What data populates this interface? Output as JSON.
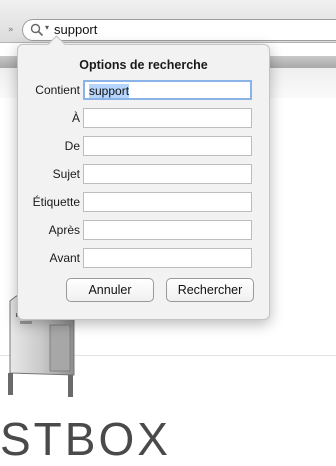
{
  "search": {
    "query": "support"
  },
  "popover": {
    "title": "Options de recherche",
    "fields": [
      {
        "label": "Contient",
        "value": "support"
      },
      {
        "label": "À",
        "value": ""
      },
      {
        "label": "De",
        "value": ""
      },
      {
        "label": "Sujet",
        "value": ""
      },
      {
        "label": "Étiquette",
        "value": ""
      },
      {
        "label": "Après",
        "value": ""
      },
      {
        "label": "Avant",
        "value": ""
      }
    ],
    "cancel_label": "Annuler",
    "search_label": "Rechercher"
  },
  "background": {
    "brand_text": "STBOX"
  },
  "colors": {
    "focus_ring": "#8ab4e8",
    "selection": "#b5d5fd"
  },
  "icons": [
    "search-icon",
    "chevron-down-icon",
    "mailbox-illustration"
  ]
}
